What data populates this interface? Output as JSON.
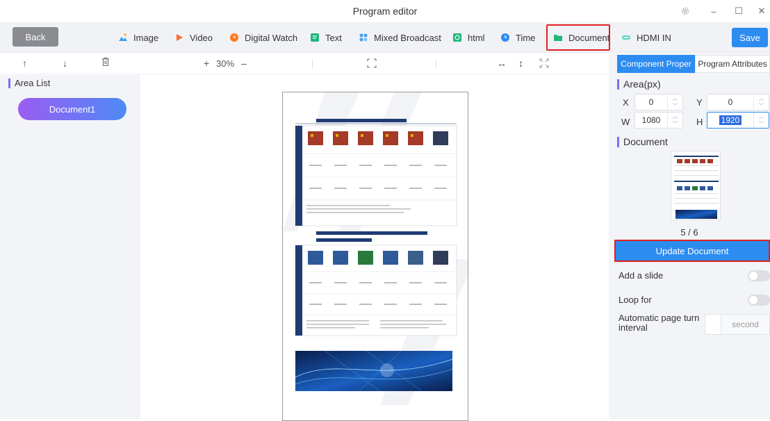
{
  "window": {
    "title": "Program editor",
    "controls": {
      "settings_icon": "gear-icon",
      "minimize": "–",
      "maximize": "☐",
      "close": "✕"
    }
  },
  "toolbar": {
    "back_label": "Back",
    "save_label": "Save",
    "items": [
      {
        "label": "Image",
        "icon": "image-icon"
      },
      {
        "label": "Video",
        "icon": "video-icon"
      },
      {
        "label": "Digital Watch",
        "icon": "digital-watch-icon"
      },
      {
        "label": "Text",
        "icon": "text-icon"
      },
      {
        "label": "Mixed Broadcast",
        "icon": "mixed-broadcast-icon"
      },
      {
        "label": "html",
        "icon": "html-icon"
      },
      {
        "label": "Time",
        "icon": "time-icon"
      },
      {
        "label": "Document",
        "icon": "document-icon"
      },
      {
        "label": "HDMI IN",
        "icon": "hdmi-icon"
      }
    ]
  },
  "subbar": {
    "zoom": "30%",
    "zoom_in": "+",
    "zoom_out": "–"
  },
  "area_list": {
    "title": "Area List",
    "items": [
      "Document1"
    ]
  },
  "properties": {
    "tabs": [
      "Component Proper",
      "Program Attributes"
    ],
    "area_title": "Area(px)",
    "x_label": "X",
    "x_value": "0",
    "y_label": "Y",
    "y_value": "0",
    "w_label": "W",
    "w_value": "1080",
    "h_label": "H",
    "h_value": "1920",
    "document_title": "Document",
    "page_indicator": "5 / 6",
    "update_button": "Update Document",
    "add_slide_label": "Add a slide",
    "loop_label": "Loop for",
    "interval_label": "Automatic page turn interval",
    "interval_unit": "second"
  },
  "colors": {
    "accent": "#2d8cf0",
    "highlight": "#e02020",
    "section_marker": "#7d6ff0"
  }
}
